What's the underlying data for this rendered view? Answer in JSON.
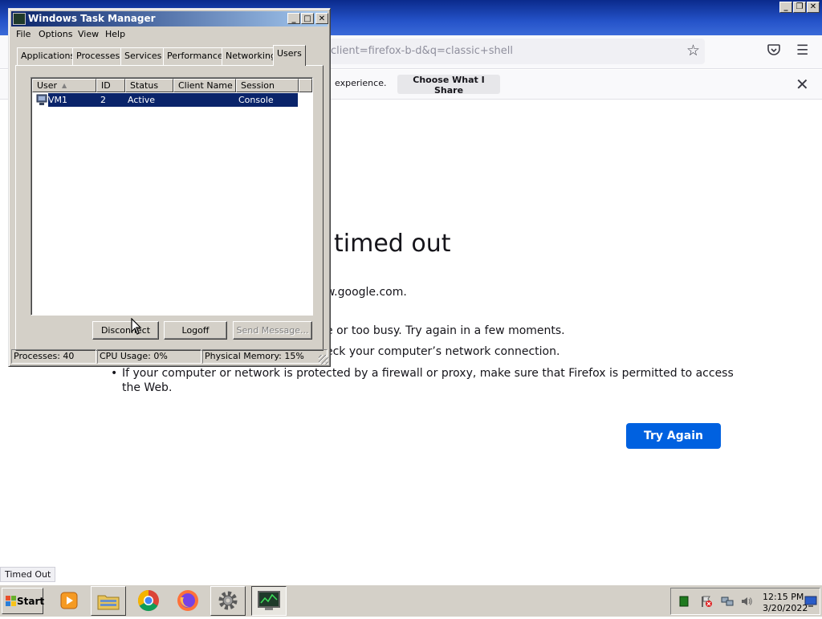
{
  "firefox": {
    "address_text": "client=firefox-b-d&q=classic+shell",
    "notice_text": "experience.",
    "notice_button": "Choose What I Share",
    "error_title": "timed out",
    "error_line1": "w.google.com.",
    "error_line2": "e or too busy. Try again in a few moments.",
    "error_line3": "eck your computer’s network connection.",
    "error_line4": "If your computer or network is protected by a firewall or proxy, make sure that Firefox is permitted to access the Web.",
    "try_again": "Try Again",
    "status_text": "Timed Out",
    "accent": "#0061e0"
  },
  "taskmgr": {
    "title": "Windows Task Manager",
    "menus": [
      "File",
      "Options",
      "View",
      "Help"
    ],
    "tabs": [
      "Applications",
      "Processes",
      "Services",
      "Performance",
      "Networking",
      "Users"
    ],
    "active_tab": "Users",
    "columns": [
      "User",
      "ID",
      "Status",
      "Client Name",
      "Session"
    ],
    "rows": [
      {
        "user": "VM1",
        "id": "2",
        "status": "Active",
        "client_name": "",
        "session": "Console"
      }
    ],
    "buttons": {
      "disconnect": "Disconnect",
      "logoff": "Logoff",
      "send_message": "Send Message..."
    },
    "status": {
      "processes": "Processes: 40",
      "cpu": "CPU Usage: 0%",
      "memory": "Physical Memory: 15%"
    },
    "selection_color": "#0a246a"
  },
  "taskbar": {
    "start_label": "Start",
    "clock_time": "12:15 PM",
    "clock_date": "3/20/2022",
    "pinned": [
      "media-player-icon",
      "file-explorer-icon",
      "chrome-icon",
      "firefox-icon",
      "settings-gear-icon",
      "task-manager-icon"
    ]
  }
}
